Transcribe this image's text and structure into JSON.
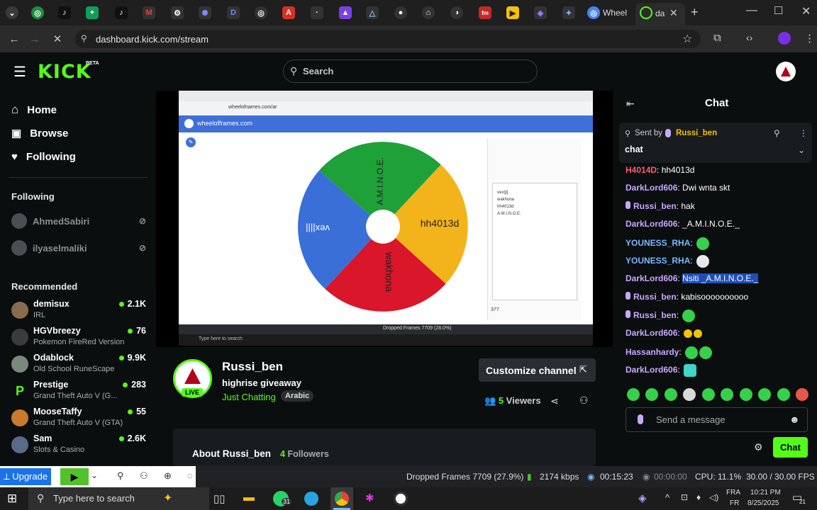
{
  "browser": {
    "tabs_active_label": "da",
    "tab_wheel_label": "Wheel",
    "url": "dashboard.kick.com/stream"
  },
  "kick": {
    "logo": "KICK",
    "beta": "BETA",
    "search_placeholder": "Search"
  },
  "sidebar": {
    "nav": [
      {
        "label": "Home",
        "icon": "home-icon"
      },
      {
        "label": "Browse",
        "icon": "browse-icon"
      },
      {
        "label": "Following",
        "icon": "heart-icon"
      }
    ],
    "following_title": "Following",
    "following": [
      "AhmedSabiri",
      "ilyaselmaliki"
    ],
    "recommended_title": "Recommended",
    "recommended": [
      {
        "name": "demisux",
        "category": "IRL",
        "viewers": "2.1K",
        "color": "#8a6b4f"
      },
      {
        "name": "HGVbreezy",
        "category": "Pokemon FireRed Version",
        "viewers": "76",
        "color": "#3b3b3b"
      },
      {
        "name": "Odablock",
        "category": "Old School RuneScape",
        "viewers": "9.9K",
        "color": "#7a8a7a"
      },
      {
        "name": "Prestige",
        "category": "Grand Theft Auto V (G...",
        "viewers": "283",
        "color": "#53fc18"
      },
      {
        "name": "MooseTaffy",
        "category": "Grand Theft Auto V (GTA)",
        "viewers": "55",
        "color": "#c97a2b"
      },
      {
        "name": "Sam",
        "category": "Slots & Casino",
        "viewers": "2.6K",
        "color": "#5a6b8a"
      }
    ]
  },
  "stream": {
    "wheel_url": "wheelofframes.com",
    "wheel_segments": [
      "A.M.I.N.O.E.",
      "hh4013d",
      "wakhona",
      "vex||||"
    ],
    "wheel_list": [
      "vex||||",
      "wakhona",
      "hh4013d",
      "A.M.I.N.O.E."
    ],
    "wheel_count": "377",
    "channel_name": "Russi_ben",
    "title": "highrise giveaway",
    "category": "Just Chatting",
    "tag": "Arabic",
    "live": "LIVE",
    "customize_label": "Customize channel",
    "viewers_count": "5",
    "viewers_label": "Viewers",
    "about_label": "About Russi_ben",
    "followers_count": "4",
    "followers_label": "Followers"
  },
  "chat": {
    "title": "Chat",
    "pinned_sent_by": "Sent by",
    "pinned_user": "Russi_ben",
    "pinned_text": "chat",
    "messages": [
      {
        "user": "H4014D",
        "color": "#ff5a7a",
        "text": "hh4013d"
      },
      {
        "user": "DarkLord606",
        "color": "#c9a8ff",
        "text": "Dwi wnta skt"
      },
      {
        "user": "Russi_ben",
        "color": "#c9a8ff",
        "text": "hak"
      },
      {
        "user": "DarkLord606",
        "color": "#c9a8ff",
        "text": "_A.M.I.N.O.E._"
      },
      {
        "user": "YOUNESS_RHA",
        "color": "#7ab8ff",
        "text": ""
      },
      {
        "user": "YOUNESS_RHA",
        "color": "#7ab8ff",
        "text": ""
      },
      {
        "user": "DarkLord606",
        "color": "#c9a8ff",
        "text": "Nsiti _A.M.I.N.O.E._"
      },
      {
        "user": "Russi_ben",
        "color": "#c9a8ff",
        "text": "kabisoooooooooo"
      },
      {
        "user": "Russi_ben",
        "color": "#c9a8ff",
        "text": ""
      },
      {
        "user": "DarkLord606",
        "color": "#c9a8ff",
        "text": ""
      },
      {
        "user": "Hassanhardy",
        "color": "#c9a8ff",
        "text": ""
      },
      {
        "user": "DarkLord606",
        "color": "#c9a8ff",
        "text": ""
      }
    ],
    "input_placeholder": "Send a message",
    "send_label": "Chat"
  },
  "obs": {
    "upgrade": "Upgrade",
    "dropped": "Dropped Frames 7709 (27.9%)",
    "kbps": "2174 kbps",
    "stream_time": "00:15:23",
    "rec_time": "00:00:00",
    "cpu": "CPU: 11.1%",
    "fps": "30.00 / 30.00 FPS"
  },
  "taskbar": {
    "search_placeholder": "Type here to search",
    "lang": "FRA",
    "lang2": "FR",
    "time": "10:21 PM",
    "date": "8/25/2025",
    "whatsapp_badge": "31",
    "notif_count": "21"
  },
  "colors": {
    "kick_green": "#53fc18"
  }
}
